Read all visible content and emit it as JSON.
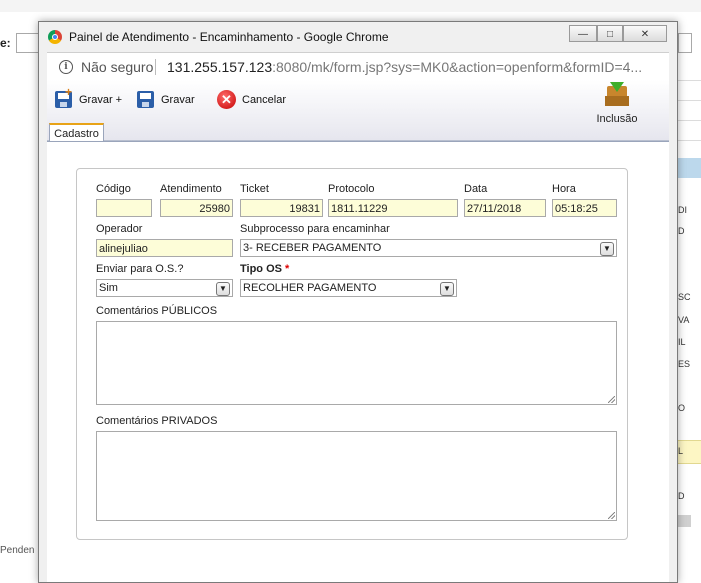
{
  "background": {
    "label": "e:",
    "bottom_text": "Penden",
    "right_cells": [
      "DI",
      "D",
      "SC",
      "VA",
      "IL",
      "ES",
      "O",
      "L",
      "D"
    ]
  },
  "window": {
    "title": "Painel de Atendimento - Encaminhamento - Google Chrome",
    "minimize": "—",
    "maximize": "□",
    "close": "✕"
  },
  "address": {
    "security": "Não seguro",
    "host": "131.255.157.123",
    "rest": ":8080/mk/form.jsp?sys=MK0&action=openform&formID=4..."
  },
  "toolbar": {
    "gravar_mais": "Gravar +",
    "gravar": "Gravar",
    "cancelar": "Cancelar",
    "inclusao": "Inclusão"
  },
  "tab": {
    "label": "Cadastro"
  },
  "form": {
    "codigo": {
      "label": "Código",
      "value": ""
    },
    "atendimento": {
      "label": "Atendimento",
      "value": "25980"
    },
    "ticket": {
      "label": "Ticket",
      "value": "19831"
    },
    "protocolo": {
      "label": "Protocolo",
      "value": "1811.11229"
    },
    "data": {
      "label": "Data",
      "value": "27/11/2018"
    },
    "hora": {
      "label": "Hora",
      "value": "05:18:25"
    },
    "operador": {
      "label": "Operador",
      "value": "alinejuliao"
    },
    "subprocesso": {
      "label": "Subprocesso para encaminhar",
      "value": "3- RECEBER PAGAMENTO"
    },
    "enviar_os": {
      "label": "Enviar para O.S.?",
      "value": "Sim"
    },
    "tipo_os": {
      "label": "Tipo OS",
      "required": "*",
      "value": "RECOLHER PAGAMENTO"
    },
    "comentarios_publicos": {
      "label": "Comentários PÚBLICOS",
      "value": ""
    },
    "comentarios_privados": {
      "label": "Comentários PRIVADOS",
      "value": ""
    }
  },
  "icons": {
    "chevron": "▼",
    "info": "i",
    "cancel": "✕",
    "plus": "+"
  }
}
